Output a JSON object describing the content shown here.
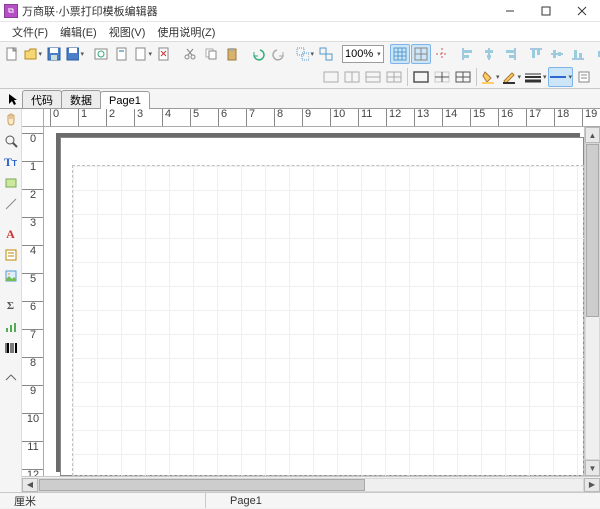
{
  "window": {
    "title": "万商联·小票打印模板编辑器"
  },
  "menu": {
    "file": "文件(F)",
    "edit": "编辑(E)",
    "view": "视图(V)",
    "help": "使用说明(Z)"
  },
  "toolbar": {
    "zoom": "100%"
  },
  "tabs": {
    "code": "代码",
    "data": "数据",
    "page": "Page1"
  },
  "ruler": {
    "h": [
      0,
      1,
      2,
      3,
      4,
      5,
      6,
      7,
      8,
      9,
      10,
      11,
      12,
      13,
      14,
      15,
      16,
      17,
      18,
      19
    ],
    "v": [
      0,
      1,
      2,
      3,
      4,
      5,
      6,
      7,
      8,
      9,
      10,
      11,
      12
    ]
  },
  "status": {
    "unit": "厘米",
    "page": "Page1"
  }
}
